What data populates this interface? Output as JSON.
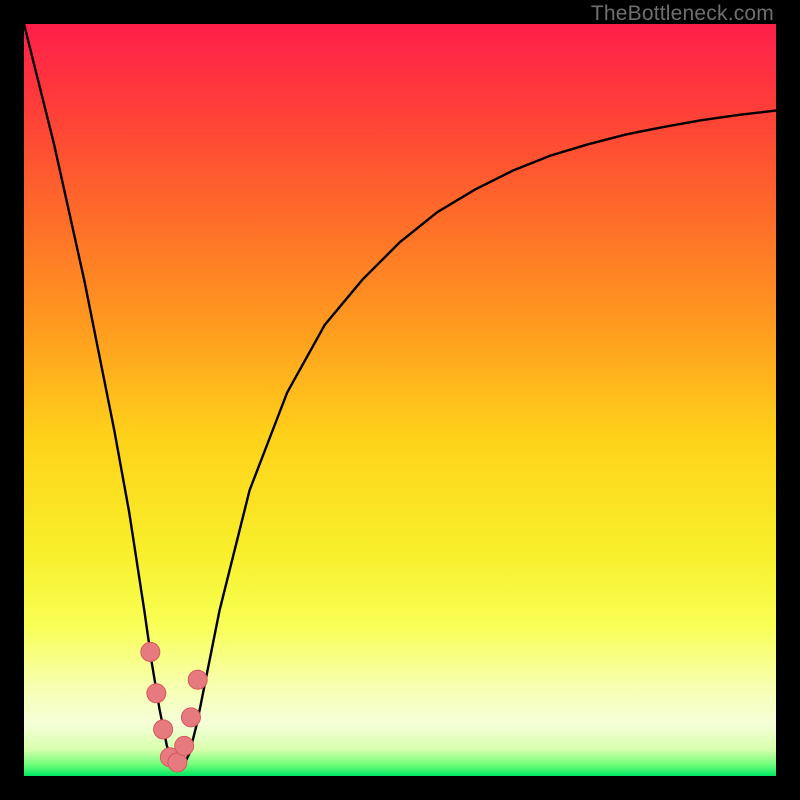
{
  "watermark": "TheBottleneck.com",
  "colors": {
    "bg_black": "#000000",
    "curve": "#000000",
    "marker_fill": "#e77a7e",
    "marker_stroke": "#d7575c",
    "gradient_stops": [
      {
        "offset": 0.0,
        "color": "#ff1f4b"
      },
      {
        "offset": 0.1,
        "color": "#ff3a3a"
      },
      {
        "offset": 0.25,
        "color": "#ff6a2a"
      },
      {
        "offset": 0.4,
        "color": "#ff9a1f"
      },
      {
        "offset": 0.55,
        "color": "#ffd21a"
      },
      {
        "offset": 0.7,
        "color": "#f8ef2a"
      },
      {
        "offset": 0.8,
        "color": "#f9ff55"
      },
      {
        "offset": 0.88,
        "color": "#f7ffb0"
      },
      {
        "offset": 0.93,
        "color": "#f6ffd8"
      },
      {
        "offset": 0.965,
        "color": "#d7ffad"
      },
      {
        "offset": 0.985,
        "color": "#6fff7a"
      },
      {
        "offset": 1.0,
        "color": "#00e763"
      }
    ]
  },
  "chart_data": {
    "type": "line",
    "title": "",
    "xlabel": "",
    "ylabel": "",
    "xlim": [
      0,
      100
    ],
    "ylim": [
      0,
      100
    ],
    "grid": false,
    "legend": false,
    "note": "V-shaped bottleneck curve; x is relative performance balance, y is bottleneck severity. Minimum (~0) near x≈20.",
    "series": [
      {
        "name": "bottleneck-curve",
        "x": [
          0,
          2,
          4,
          6,
          8,
          10,
          12,
          14,
          16,
          17,
          18,
          19,
          20,
          21,
          22,
          23,
          24,
          26,
          30,
          35,
          40,
          45,
          50,
          55,
          60,
          65,
          70,
          75,
          80,
          85,
          90,
          95,
          100
        ],
        "y": [
          100,
          92,
          84,
          75,
          66,
          56,
          46,
          35,
          22,
          15,
          9,
          4,
          1,
          1,
          3,
          7,
          12,
          22,
          38,
          51,
          60,
          66,
          71,
          75,
          78,
          80.5,
          82.5,
          84,
          85.3,
          86.3,
          87.2,
          87.9,
          88.5
        ]
      }
    ],
    "markers": {
      "name": "highlight-points",
      "x": [
        16.8,
        17.6,
        18.5,
        19.4,
        20.4,
        21.3,
        22.2,
        23.1
      ],
      "y": [
        16.5,
        11.0,
        6.2,
        2.5,
        1.8,
        4.0,
        7.8,
        12.8
      ]
    }
  }
}
